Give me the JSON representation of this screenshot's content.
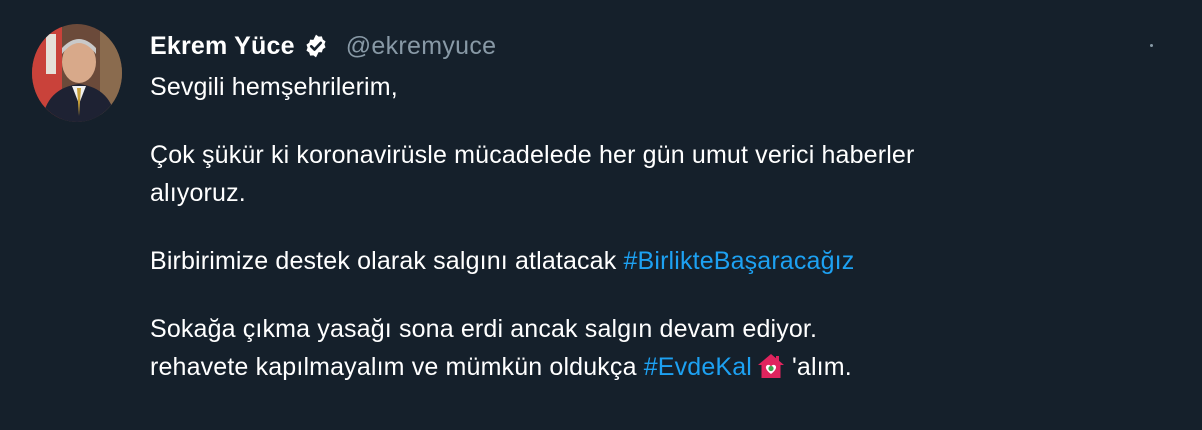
{
  "tweet": {
    "author": {
      "name": "Ekrem Yüce",
      "handle": "@ekremyuce",
      "verified": true,
      "avatar_icon": "profile-photo"
    },
    "text": {
      "line1": "Sevgili hemşehrilerim,",
      "line2": "Çok şükür ki koronavirüsle mücadelede her gün umut verici haberler",
      "line3": "alıyoruz.",
      "line4_text": "Birbirimize destek olarak salgını atlatacak ",
      "line4_hashtag": "#BirlikteBaşaracağız",
      "line5": "Sokağa çıkma yasağı sona erdi ancak salgın devam ediyor.",
      "line6_text": "rehavete kapılmayalım ve mümkün oldukça ",
      "line6_hashtag": "#EvdeKal",
      "line6_emoji": "house-with-heart-emoji",
      "line6_suffix": "'alım."
    },
    "colors": {
      "background": "#15202b",
      "text": "#ffffff",
      "muted": "#8899a6",
      "link": "#1da1f2"
    }
  }
}
